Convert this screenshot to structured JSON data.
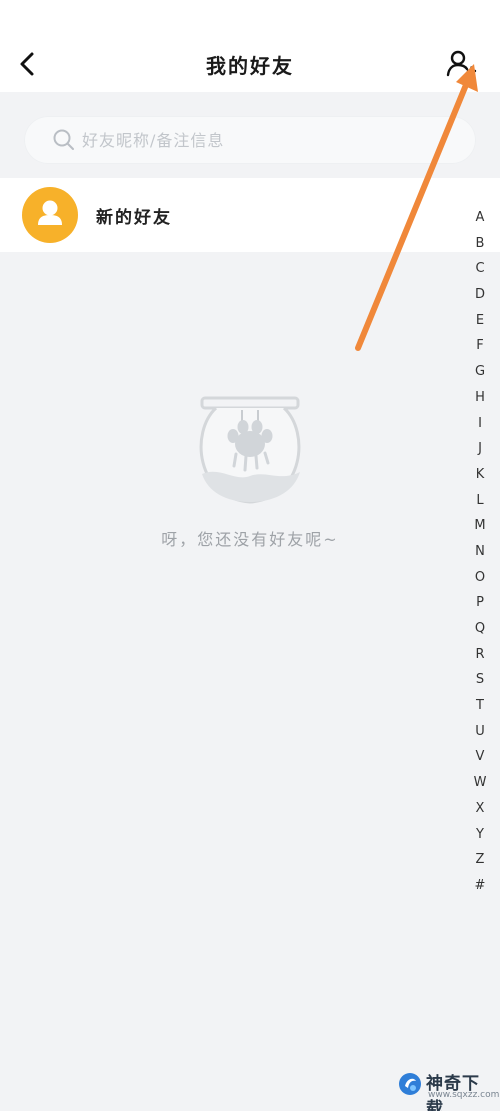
{
  "header": {
    "title": "我的好友",
    "back_icon": "chevron-left-icon",
    "add_friend_icon": "person-add-icon"
  },
  "search": {
    "placeholder": "好友昵称/备注信息",
    "value": "",
    "icon": "search-icon"
  },
  "new_friends": {
    "label": "新的好友",
    "avatar_icon": "person-icon",
    "avatar_color": "#f7b12a"
  },
  "index_bar": {
    "letters": [
      "A",
      "B",
      "C",
      "D",
      "E",
      "F",
      "G",
      "H",
      "I",
      "J",
      "K",
      "L",
      "M",
      "N",
      "O",
      "P",
      "Q",
      "R",
      "S",
      "T",
      "U",
      "V",
      "W",
      "X",
      "Y",
      "Z",
      "#"
    ]
  },
  "empty_state": {
    "message": "呀，您还没有好友呢~",
    "illustration_icon": "fishbowl-paw-icon"
  },
  "annotation": {
    "arrow_color": "#f0883a",
    "arrow_target": "add-friend-button"
  },
  "watermark": {
    "text": "神奇下载",
    "url": "www.sqxzz.com"
  }
}
